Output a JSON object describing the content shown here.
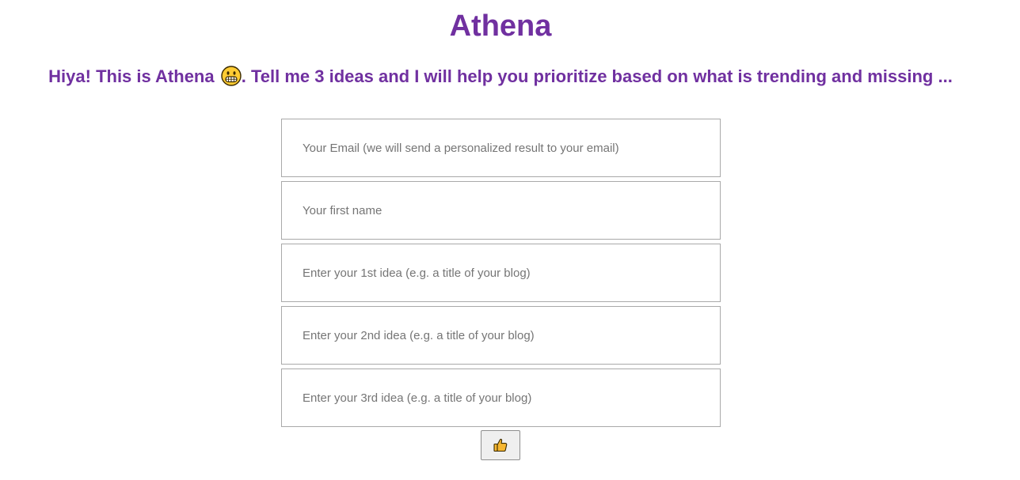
{
  "colors": {
    "accent": "#7030a0",
    "border": "#a9a9a9",
    "placeholder": "#757575",
    "button_bg": "#efefef"
  },
  "header": {
    "title": "Athena",
    "subtitle_before_emoji": "Hiya! This is Athena ",
    "subtitle_emoji_icon": "grinning-face-icon",
    "subtitle_after_emoji": ". Tell me 3 ideas and I will help you prioritize based on what is trending and missing ..."
  },
  "form": {
    "email_placeholder": "Your Email (we will send a personalized result to your email)",
    "first_name_placeholder": "Your first name",
    "idea1_placeholder": "Enter your 1st idea (e.g. a title of your blog)",
    "idea2_placeholder": "Enter your 2nd idea (e.g. a title of your blog)",
    "idea3_placeholder": "Enter your 3rd idea (e.g. a title of your blog)",
    "submit_icon": "thumbs-up-icon"
  }
}
